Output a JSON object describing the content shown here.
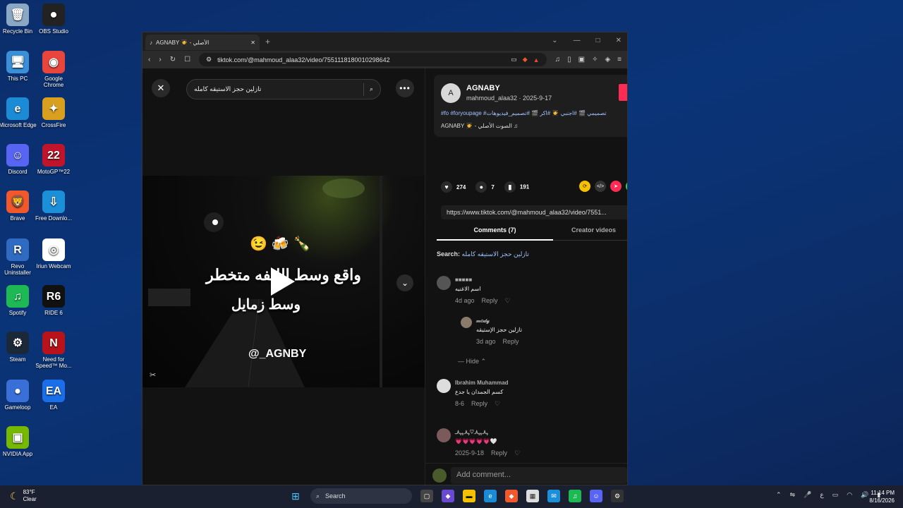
{
  "desktop": {
    "icons": [
      {
        "label": "Recycle Bin",
        "glyph": "🗑",
        "color": "#8aa7c4"
      },
      {
        "label": "OBS Studio",
        "glyph": "⏺",
        "color": "#222"
      },
      {
        "label": "This PC",
        "glyph": "🖥",
        "color": "#3a8fd6"
      },
      {
        "label": "Google Chrome",
        "glyph": "◉",
        "color": "#e8453c"
      },
      {
        "label": "Microsoft Edge",
        "glyph": "e",
        "color": "#1c8bd6"
      },
      {
        "label": "CrossFire",
        "glyph": "✦",
        "color": "#d9a020"
      },
      {
        "label": "Discord",
        "glyph": "☺",
        "color": "#5865f2"
      },
      {
        "label": "MotoGP™22",
        "glyph": "22",
        "color": "#c0142a"
      },
      {
        "label": "Brave",
        "glyph": "🦁",
        "color": "#f1582b"
      },
      {
        "label": "Free Downlo...",
        "glyph": "⇩",
        "color": "#1b8fd8"
      },
      {
        "label": "Revo Uninstaller",
        "glyph": "R",
        "color": "#2f6cc1"
      },
      {
        "label": "Iriun Webcam",
        "glyph": "◎",
        "color": "#ffffff"
      },
      {
        "label": "Spotify",
        "glyph": "♫",
        "color": "#1db954"
      },
      {
        "label": "RIDE 6",
        "glyph": "R6",
        "color": "#111"
      },
      {
        "label": "Steam",
        "glyph": "⚙",
        "color": "#1b2838"
      },
      {
        "label": "Need for Speed™ Mo...",
        "glyph": "N",
        "color": "#b8131a"
      },
      {
        "label": "Gameloop",
        "glyph": "●",
        "color": "#3a6fd8"
      },
      {
        "label": "EA",
        "glyph": "EA",
        "color": "#1a6fe8"
      },
      {
        "label": "NVIDIA App",
        "glyph": "▣",
        "color": "#76b900"
      }
    ]
  },
  "browser": {
    "tab_title": "AGNABY 🧑‍🎓 - الأصلي",
    "url": "tiktok.com/@mahmoud_alaa32/video/7551118180010298642"
  },
  "video_pane": {
    "search_query": "تازلين حجز الاستيقه كامله",
    "emojis": "😉🍻🍾",
    "caption_line1": "واقع وسط الليفه متخطر",
    "caption_line2": "وسط زمايل",
    "watermark": "@_AGNBY"
  },
  "author": {
    "display_name": "AGNABY",
    "handle_date": "mahmoud_alaa32 · 2025-9-17",
    "description_tags": "#fo #foryoupage #تصميمي 🎬 #اجنبي 🧑‍🎓 #اكر 🎬 #تصميم_فيديوهات ",
    "music": "AGNABY 🧑‍🎓 - الصوت الأصلي ♫",
    "avatar_letter": "A"
  },
  "stats": {
    "likes": "274",
    "comments": "7",
    "saves": "191"
  },
  "share_link": "https://www.tiktok.com/@mahmoud_alaa32/video/7551...",
  "tabs": {
    "comments": "Comments (7)",
    "creator": "Creator videos"
  },
  "search_line": {
    "label": "Search:",
    "query": "تازلين حجز الاستيقه كامله"
  },
  "comments": [
    {
      "name": "■■■■■",
      "text": "اسم الاغنيه",
      "date": "4d ago",
      "reply": "Reply"
    },
    {
      "name": "𝓂𝑜𝒹𝓎",
      "text": "تازلين حجز الإستيقه",
      "date": "3d ago",
      "reply": "Reply"
    },
    {
      "name": "Ibrahim Muhammad",
      "text": "كسم الجمدان يا جدع",
      "date": "8-6",
      "reply": "Reply"
    },
    {
      "name": "ﮩ٨ـﮩﮩ٨ـ♡ﮩ٨ـﮩﮩ٨ـ",
      "text": "💗💗💗💗💗🤍",
      "date": "2025-9-18",
      "reply": "Reply"
    }
  ],
  "hide_label": "Hide",
  "add_comment_placeholder": "Add comment...",
  "taskbar": {
    "temp": "83°F",
    "weather": "Clear",
    "search": "Search",
    "time": "11:14 PM",
    "date": "8/16/2026"
  }
}
